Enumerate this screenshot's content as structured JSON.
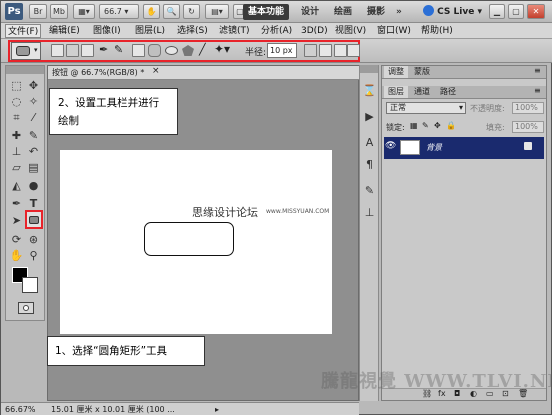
{
  "appbar": {
    "logo": "Ps",
    "br": "Br",
    "mb": "Mb",
    "zoom": "66.7",
    "workspaces": [
      "基本功能",
      "设计",
      "绘画",
      "摄影"
    ],
    "more": "»",
    "cslive": "CS Live"
  },
  "menubar": [
    "文件(F)",
    "编辑(E)",
    "图像(I)",
    "图层(L)",
    "选择(S)",
    "滤镜(T)",
    "分析(A)",
    "3D(D)",
    "视图(V)",
    "窗口(W)",
    "帮助(H)"
  ],
  "options": {
    "radius_label": "半径:",
    "radius_value": "10 px"
  },
  "document": {
    "tab_title": "按钮 @ 66.7%(RGB/8) *",
    "watermark": "思缘设计论坛",
    "watermark_url": "www.MISSYUAN.COM"
  },
  "callouts": {
    "step2_line1": "2、设置工具栏并进行",
    "step2_line2": "绘制",
    "step1": "1、选择“圆角矩形”工具"
  },
  "status": {
    "zoom": "66.67%",
    "doc_size": "15.01 厘米 x 10.01 厘米 (100 ..."
  },
  "panels": {
    "adjust_tabs": [
      "调整",
      "蒙版"
    ],
    "layer_tabs": [
      "图层",
      "通道",
      "路径"
    ],
    "blend_mode": "正常",
    "opacity_label": "不透明度:",
    "opacity_value": "100%",
    "lock_label": "锁定:",
    "fill_label": "填充:",
    "fill_value": "100%",
    "layer_name": "背景"
  },
  "bottom_watermark": "騰龍視覺 WWW.TLVI.NET",
  "colors": {
    "highlight": "#e8232a",
    "layer_selected": "#1a2a6e"
  }
}
